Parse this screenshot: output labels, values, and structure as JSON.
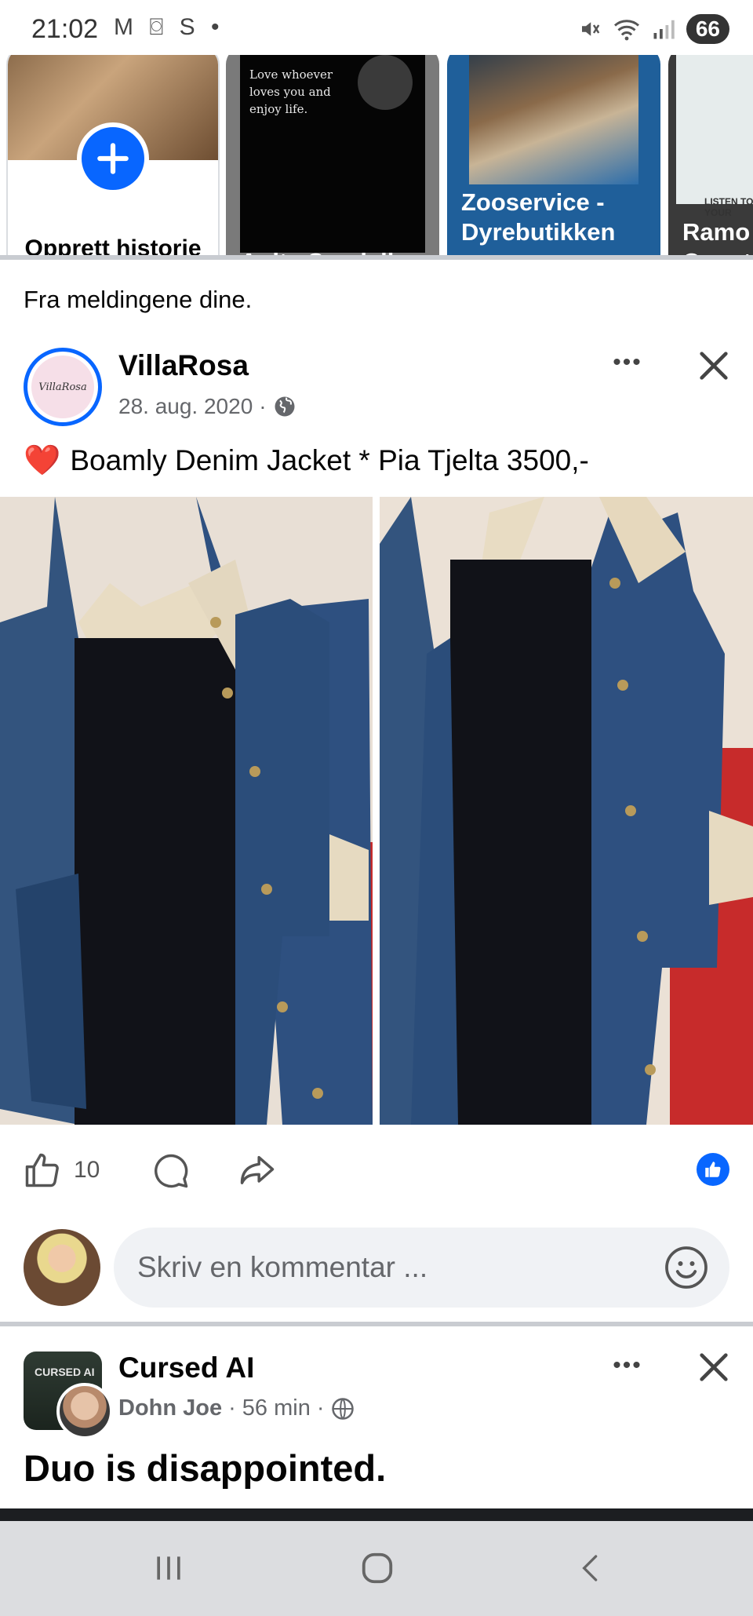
{
  "status_bar": {
    "time": "21:02",
    "notif_icons": "M ⌼ S •",
    "battery": "66"
  },
  "stories": {
    "create_label": "Opprett historie",
    "items": [
      {
        "name": "Anita Sandvik",
        "quote": "Love whoever loves you and enjoy life."
      },
      {
        "name": "Zooservice - Dyrebutikken ..."
      },
      {
        "name": "Ramo Const",
        "tag": "LISTEN TO YOUR"
      }
    ]
  },
  "section_note": "Fra meldingene dine.",
  "post1": {
    "author": "VillaRosa",
    "avatar_text": "VillaRosa",
    "date": "28. aug. 2020",
    "dot": "·",
    "text": "Boamly Denim Jacket * Pia Tjelta 3500,-",
    "likes": "10",
    "comment_placeholder": "Skriv en kommentar ..."
  },
  "post2": {
    "group": "Cursed AI",
    "group_thumb_text": "CURSED AI",
    "author": "Dohn Joe",
    "time": "56 min",
    "dot": "·",
    "title": "Duo is disappointed."
  },
  "icons": {
    "more": "•••",
    "close": "✕",
    "heart": "❤️",
    "globe": "🌐",
    "emoji": "☺"
  },
  "colors": {
    "brand_blue": "#0866ff",
    "gray_text": "#65676b",
    "comment_bg": "#f0f2f5"
  }
}
